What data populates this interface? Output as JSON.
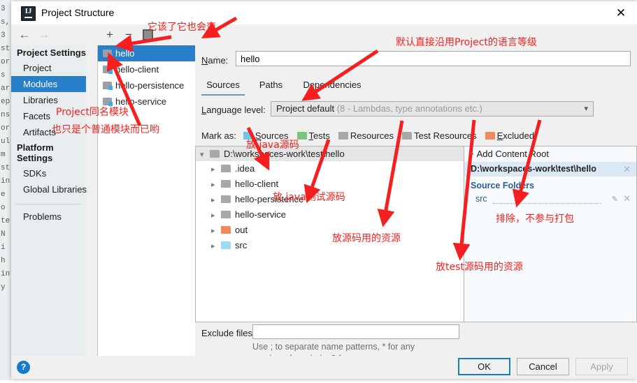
{
  "window": {
    "title": "Project Structure",
    "app_icon": "intellij-idea-icon",
    "close_label": "✕"
  },
  "nav": {
    "back": "←",
    "forward": "→"
  },
  "sidebar": {
    "groups": [
      {
        "header": "Project Settings",
        "items": [
          {
            "label": "Project",
            "selected": false
          },
          {
            "label": "Modules",
            "selected": true
          },
          {
            "label": "Libraries",
            "selected": false
          },
          {
            "label": "Facets",
            "selected": false
          },
          {
            "label": "Artifacts",
            "selected": false
          }
        ]
      },
      {
        "header": "Platform Settings",
        "items": [
          {
            "label": "SDKs",
            "selected": false
          },
          {
            "label": "Global Libraries",
            "selected": false
          }
        ]
      }
    ],
    "problems": "Problems"
  },
  "modules_toolbar": {
    "add": "+",
    "remove": "−",
    "copy": "copy-icon"
  },
  "modules": [
    {
      "label": "hello",
      "selected": true
    },
    {
      "label": "hello-client",
      "selected": false
    },
    {
      "label": "hello-persistence",
      "selected": false
    },
    {
      "label": "hello-service",
      "selected": false
    }
  ],
  "module_form": {
    "name_label": "Name:",
    "name_value": "hello",
    "tabs": [
      {
        "label": "Sources",
        "active": true
      },
      {
        "label": "Paths",
        "active": false
      },
      {
        "label": "Dependencies",
        "active": false
      }
    ],
    "language_level_label": "Language level:",
    "language_level_value": "Project default",
    "language_level_detail": "(8 - Lambdas, type annotations etc.)",
    "mark_as_label": "Mark as:",
    "mark_as": [
      {
        "label": "Sources",
        "color": "#74c3e8"
      },
      {
        "label": "Tests",
        "color": "#7cc47c"
      },
      {
        "label": "Resources",
        "color": "#a8a8a8"
      },
      {
        "label": "Test Resources",
        "color": "#a8a8a8"
      },
      {
        "label": "Excluded",
        "color": "#ef8a5a"
      }
    ],
    "exclude_label": "Exclude files:",
    "exclude_value": "",
    "exclude_hint_line1": "Use ; to separate name patterns, * for any",
    "exclude_hint_line2": "number of symbols, ? for one."
  },
  "tree": {
    "root": "D:\\workspaces-work\\test\\hello",
    "rows": [
      {
        "label": ".idea",
        "color": "#a8a8a8"
      },
      {
        "label": "hello-client",
        "color": "#a8a8a8"
      },
      {
        "label": "hello-persistence",
        "color": "#a8a8a8"
      },
      {
        "label": "hello-service",
        "color": "#a8a8a8"
      },
      {
        "label": "out",
        "color": "#ef8a5a"
      },
      {
        "label": "src",
        "color": "#9fd9f0"
      }
    ]
  },
  "content_root": {
    "add_label": "Add Content Root",
    "path": "D:\\workspaces-work\\test\\hello",
    "source_folders_label": "Source Folders",
    "source_folder": "src",
    "remove_icon": "✕",
    "edit_icon": "pencil-icon"
  },
  "footer": {
    "help": "?",
    "ok": "OK",
    "cancel": "Cancel",
    "apply": "Apply"
  },
  "annotations": {
    "a1": "它该了它也会变",
    "a2": "默认直接沿用Project的语言等级",
    "a3": "Project同名模块",
    "a4": "也只是个普通模块而已哟",
    "a5": "放.java源码",
    "a6": "放.java测试源码",
    "a7": "放源码用的资源",
    "a8": "放test源码用的资源",
    "a9": "排除，不参与打包",
    "color": "#f42020"
  },
  "ide_background": {
    "lines": [
      "3",
      "s,",
      "3",
      "st",
      "or",
      "s",
      "ar",
      "ep",
      "ns",
      "or",
      "ul",
      "m",
      "st",
      "in",
      "e",
      "o",
      "te",
      "N",
      "i",
      "h",
      "in",
      "y"
    ]
  }
}
